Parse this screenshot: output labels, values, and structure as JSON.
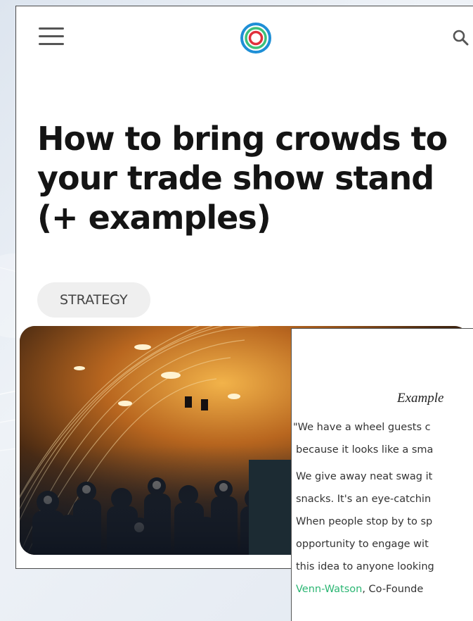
{
  "header": {
    "menu_icon": "hamburger-menu-icon",
    "logo_icon": "concentric-circles-logo-icon",
    "search_icon": "search-icon"
  },
  "article": {
    "title": "How to bring crowds to your trade show stand (+ examples)",
    "category": "STRATEGY",
    "hero_image": "conference-audience-photo"
  },
  "overlay": {
    "heading": "Example",
    "lines": [
      "\"We have a wheel guests c",
      "because it looks like a sma",
      "We give away neat swag it",
      "snacks. It's an eye-catchin",
      "When people stop by to sp",
      "opportunity to engage wit",
      "this idea to anyone looking"
    ],
    "author_name": "Venn-Watson",
    "author_suffix": ", Co-Founde"
  },
  "colors": {
    "title_text": "#141414",
    "tag_background": "#efefef",
    "link_green": "#2bb673",
    "logo_outer_blue": "#1e8fd6",
    "logo_green": "#3cc07a",
    "logo_red": "#e0303c"
  }
}
